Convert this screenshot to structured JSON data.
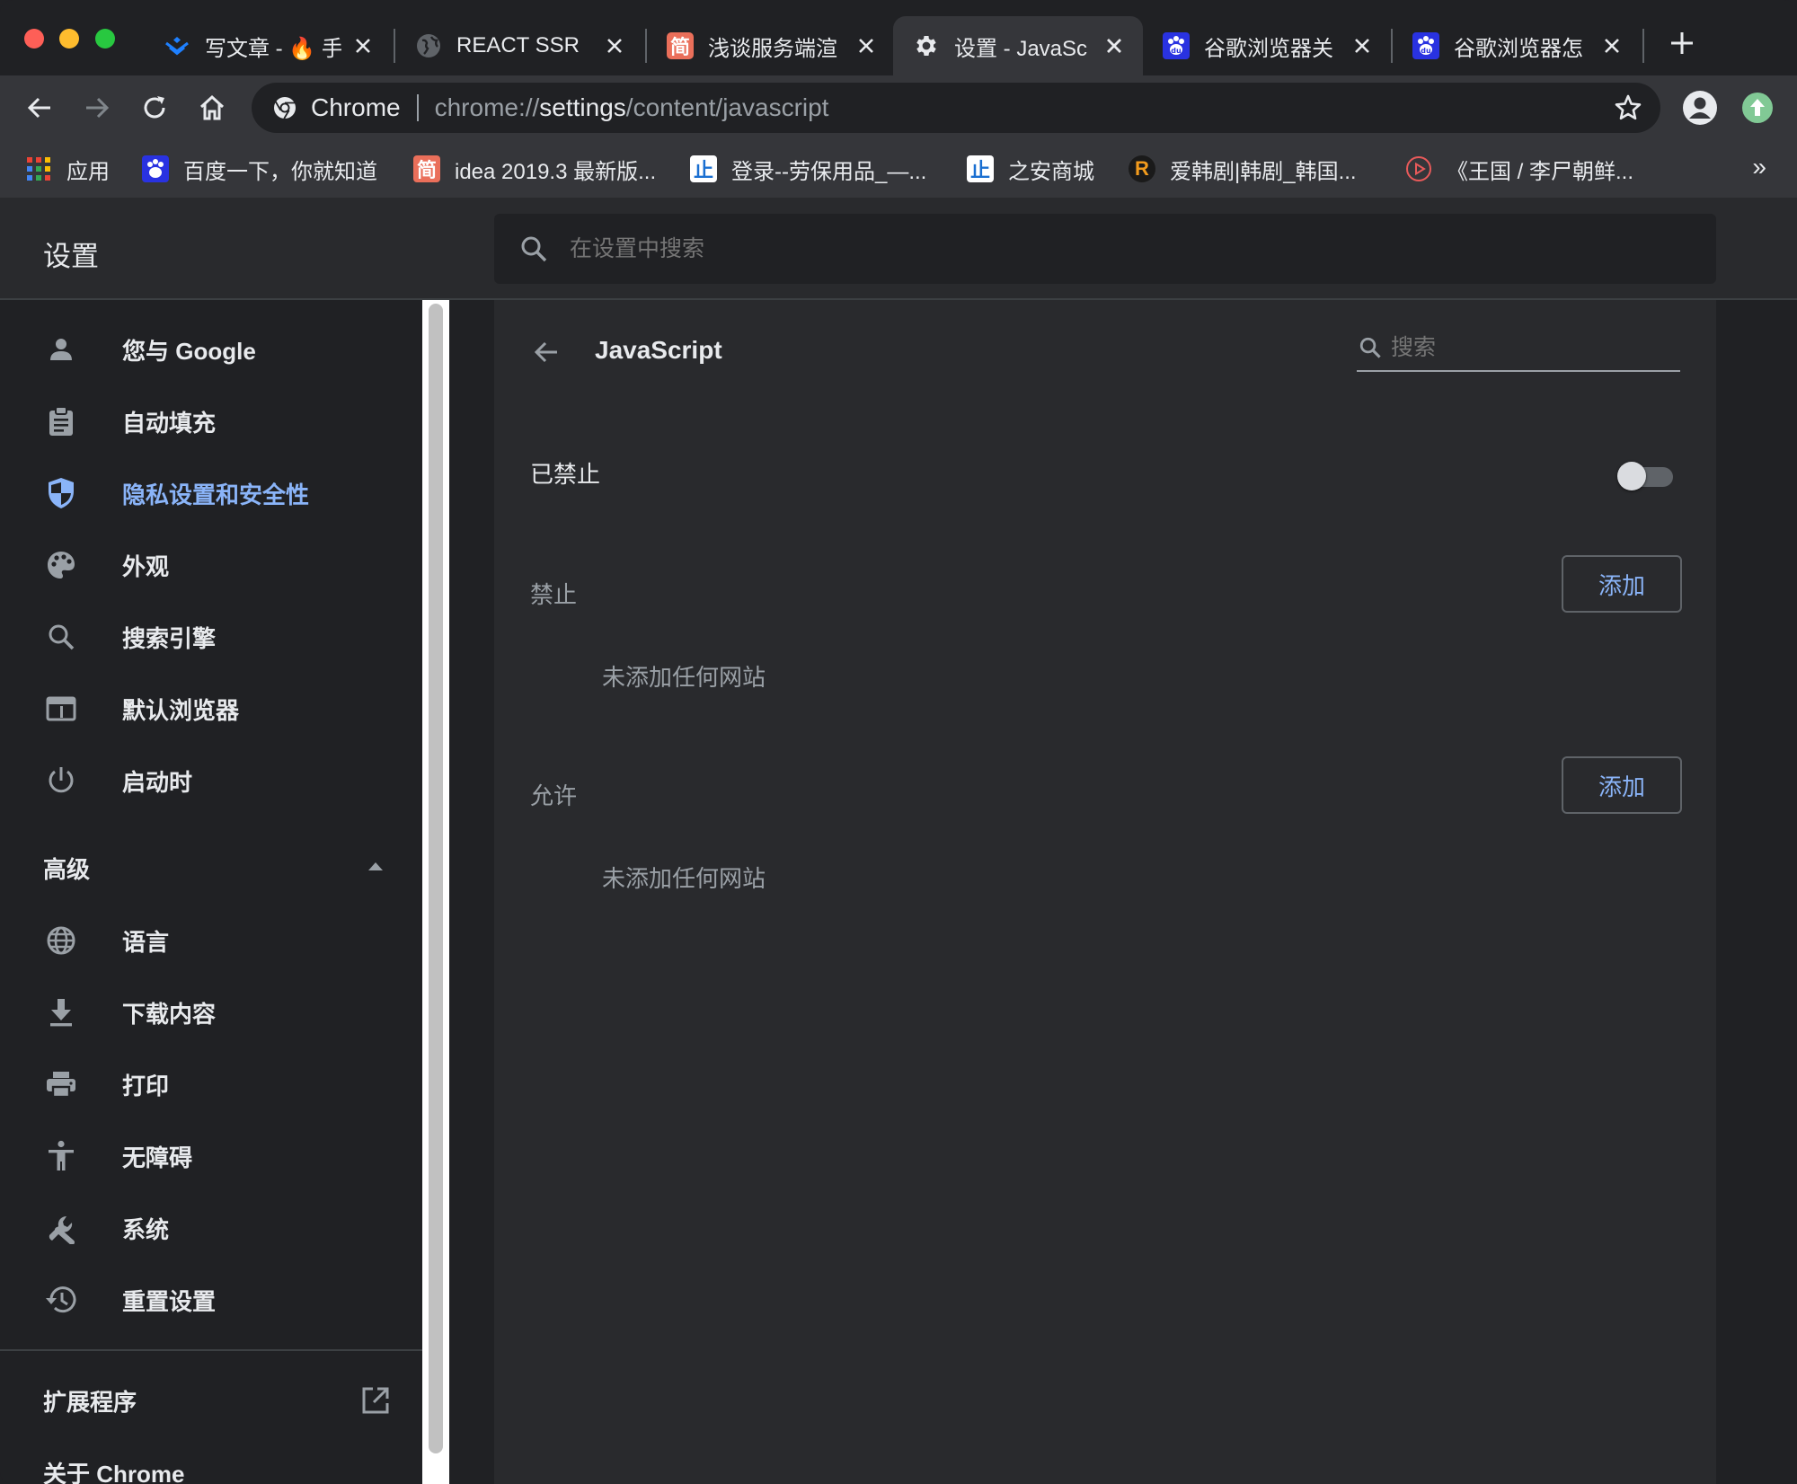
{
  "tabs": [
    {
      "title": "写文章 - 🔥 手",
      "icon": "juejin-logo-icon"
    },
    {
      "title": "REACT SSR",
      "icon": "globe-icon"
    },
    {
      "title": "浅谈服务端渲",
      "icon": "jianshu-logo-icon",
      "icon_text": "简"
    },
    {
      "title": "设置 - JavaSc",
      "icon": "gear-icon",
      "active": true
    },
    {
      "title": "谷歌浏览器关",
      "icon": "baidu-paw-icon"
    },
    {
      "title": "谷歌浏览器怎",
      "icon": "baidu-paw-icon"
    }
  ],
  "omnibox": {
    "chip": "Chrome",
    "url_scheme": "chrome://",
    "url_host": "settings",
    "url_path": "/content/javascript"
  },
  "bookmarks": [
    {
      "label": "应用",
      "icon": "apps-grid-icon"
    },
    {
      "label": "百度一下，你就知道",
      "icon": "baidu-paw-icon"
    },
    {
      "label": "idea 2019.3 最新版...",
      "icon": "jianshu-logo-icon",
      "icon_text": "简"
    },
    {
      "label": "登录--劳保用品_—...",
      "icon": "zhian-logo-icon",
      "icon_text": "止"
    },
    {
      "label": "之安商城",
      "icon": "zhian-logo-icon",
      "icon_text": "止"
    },
    {
      "label": "爱韩剧|韩剧_韩国...",
      "icon": "r-logo-icon",
      "icon_text": "R"
    },
    {
      "label": "《王国 / 李尸朝鲜...",
      "icon": "play-circle-icon"
    }
  ],
  "bookmarks_more": "»",
  "settings": {
    "title": "设置",
    "search_placeholder": "在设置中搜索"
  },
  "sidebar": {
    "items": [
      {
        "label": "您与 Google",
        "icon": "person-icon"
      },
      {
        "label": "自动填充",
        "icon": "clipboard-icon"
      },
      {
        "label": "隐私设置和安全性",
        "icon": "shield-icon",
        "selected": true
      },
      {
        "label": "外观",
        "icon": "palette-icon"
      },
      {
        "label": "搜索引擎",
        "icon": "search-icon"
      },
      {
        "label": "默认浏览器",
        "icon": "browser-window-icon"
      },
      {
        "label": "启动时",
        "icon": "power-icon"
      }
    ],
    "advanced_label": "高级",
    "advanced_items": [
      {
        "label": "语言",
        "icon": "globe-icon"
      },
      {
        "label": "下载内容",
        "icon": "download-icon"
      },
      {
        "label": "打印",
        "icon": "printer-icon"
      },
      {
        "label": "无障碍",
        "icon": "accessibility-icon"
      },
      {
        "label": "系统",
        "icon": "wrench-icon"
      },
      {
        "label": "重置设置",
        "icon": "history-icon"
      }
    ],
    "extensions_label": "扩展程序",
    "about_label": "关于 Chrome"
  },
  "page": {
    "title": "JavaScript",
    "search_placeholder": "搜索",
    "toggle_label": "已禁止",
    "toggle_on": false,
    "blocked": {
      "label": "禁止",
      "add_label": "添加",
      "empty_text": "未添加任何网站"
    },
    "allowed": {
      "label": "允许",
      "add_label": "添加",
      "empty_text": "未添加任何网站"
    }
  },
  "colors": {
    "accent": "#8ab4f8",
    "background": "#202124",
    "card": "#292a2d",
    "toolbar": "#35363a",
    "text": "#e8eaed",
    "muted": "#9aa0a6"
  }
}
